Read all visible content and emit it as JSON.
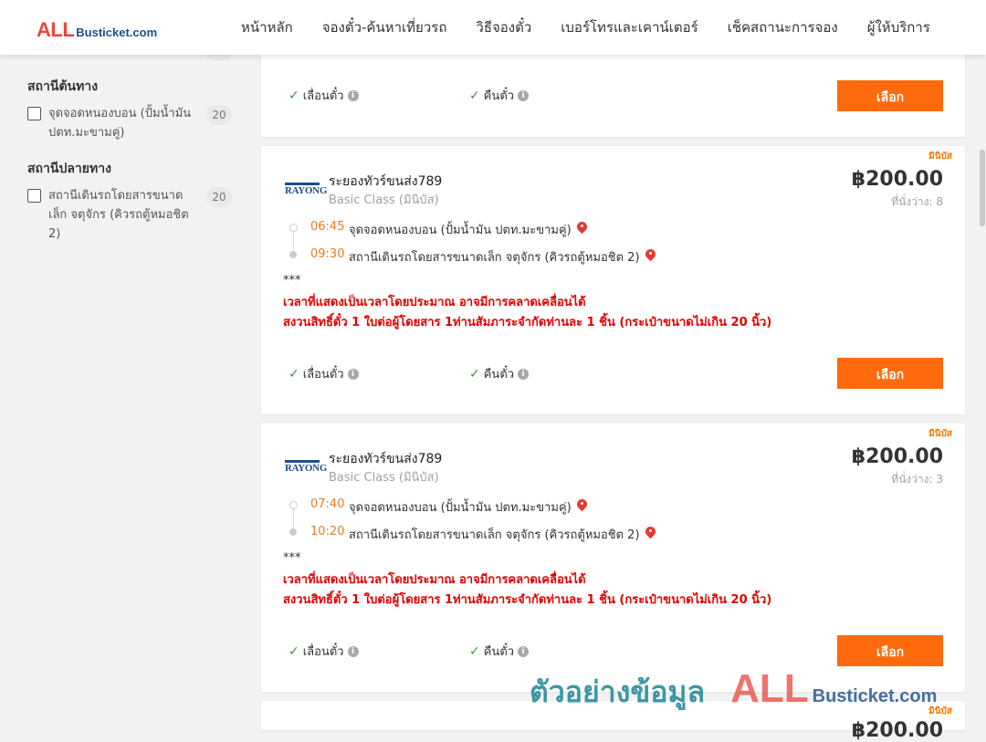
{
  "logo": {
    "all": "ALL",
    "busticket": "Busticket.com"
  },
  "nav": [
    "หน้าหลัก",
    "จองตั๋ว-ค้นหาเที่ยวรถ",
    "วิธีจองตั๋ว",
    "เบอร์โทรและเคาน์เตอร์",
    "เช็คสถานะการจอง",
    "ผู้ให้บริการ"
  ],
  "sidebar": {
    "origin": {
      "title": "สถานีต้นทาง",
      "label": "จุดจอดหนองบอน (ปั้มน้ำมัน ปตท.มะขามคู่)",
      "count": "20"
    },
    "destination": {
      "title": "สถานีปลายทาง",
      "label": "สถานีเดินรถโดยสารขนาดเล็ก จตุจักร (คิวรถตู้หมอชิต 2)",
      "count": "20"
    }
  },
  "options": {
    "change": "เลื่อนตั๋ว",
    "refund": "คืนตั๋ว",
    "select": "เลือก"
  },
  "icons": {
    "check": "check-icon",
    "info": "info-icon",
    "pin": "map-pin-icon",
    "checkbox": "checkbox-icon"
  },
  "colors": {
    "accent": "#ff6a0c",
    "time": "#e67e22",
    "warning": "#e00000",
    "brand_red": "#e8473c",
    "brand_blue": "#1c4f8a"
  },
  "trips": [
    {
      "badge": "มินิบัส",
      "operator_logo": "RAYONG",
      "operator": "ระยองทัวร์ขนส่ง789",
      "class": "Basic Class (มินิบัส)",
      "price": "฿200.00",
      "seats": "ที่นั่งว่าง: 8",
      "depart_time": "06:45",
      "depart_place": "จุดจอดหนองบอน (ปั้มน้ำมัน ปตท.มะขามคู่)",
      "arrive_time": "09:30",
      "arrive_place": "สถานีเดินรถโดยสารขนาดเล็ก จตุจักร (คิวรถตู้หมอชิต 2)",
      "note_mark": "***",
      "warn1": "เวลาที่แสดงเป็นเวลาโดยประมาณ อาจมีการคลาดเคลื่อนได้",
      "warn2": "สงวนสิทธิ์ตั๋ว 1 ใบต่อผู้โดยสาร 1ท่านสัมภาระจำกัดท่านละ 1 ชิ้น (กระเป๋าขนาดไม่เกิน 20 นิ้ว)"
    },
    {
      "badge": "มินิบัส",
      "operator_logo": "RAYONG",
      "operator": "ระยองทัวร์ขนส่ง789",
      "class": "Basic Class (มินิบัส)",
      "price": "฿200.00",
      "seats": "ที่นั่งว่าง: 3",
      "depart_time": "07:40",
      "depart_place": "จุดจอดหนองบอน (ปั้มน้ำมัน ปตท.มะขามคู่)",
      "arrive_time": "10:20",
      "arrive_place": "สถานีเดินรถโดยสารขนาดเล็ก จตุจักร (คิวรถตู้หมอชิต 2)",
      "note_mark": "***",
      "warn1": "เวลาที่แสดงเป็นเวลาโดยประมาณ อาจมีการคลาดเคลื่อนได้",
      "warn2": "สงวนสิทธิ์ตั๋ว 1 ใบต่อผู้โดยสาร 1ท่านสัมภาระจำกัดท่านละ 1 ชิ้น (กระเป๋าขนาดไม่เกิน 20 นิ้ว)"
    },
    {
      "badge": "มินิบัส",
      "price": "฿200.00"
    }
  ],
  "watermark": {
    "thai": "ตัวอย่างข้อมูล",
    "all": "ALL",
    "busticket": "Busticket.com"
  }
}
